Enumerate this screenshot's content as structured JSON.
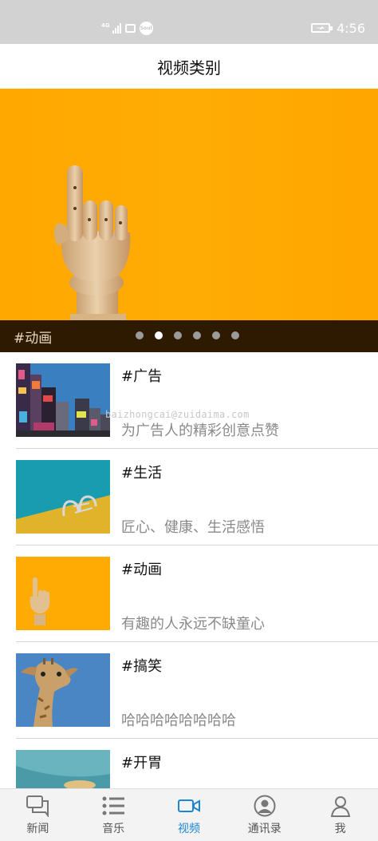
{
  "status_bar": {
    "network": "4G",
    "time": "4:56",
    "soul_badge": "Soul"
  },
  "header": {
    "title": "视频类别"
  },
  "banner": {
    "caption": "#动画",
    "slide_count": 6,
    "active_slide": 1
  },
  "watermark": "baizhongcai@zuidaima.com",
  "categories": [
    {
      "title": "#广告",
      "desc": "为广告人的精彩创意点赞"
    },
    {
      "title": "#生活",
      "desc": "匠心、健康、生活感悟"
    },
    {
      "title": "#动画",
      "desc": "有趣的人永远不缺童心"
    },
    {
      "title": "#搞笑",
      "desc": "哈哈哈哈哈哈哈哈"
    },
    {
      "title": "#开胃",
      "desc": ""
    }
  ],
  "tabs": [
    {
      "label": "新闻",
      "icon": "chat-icon"
    },
    {
      "label": "音乐",
      "icon": "list-icon"
    },
    {
      "label": "视频",
      "icon": "video-icon",
      "active": true
    },
    {
      "label": "通讯录",
      "icon": "contacts-icon"
    },
    {
      "label": "我",
      "icon": "person-icon"
    }
  ],
  "colors": {
    "banner": "#ffab03",
    "active_tab": "#1d86d2",
    "status_bar": "#d2d2d2"
  }
}
